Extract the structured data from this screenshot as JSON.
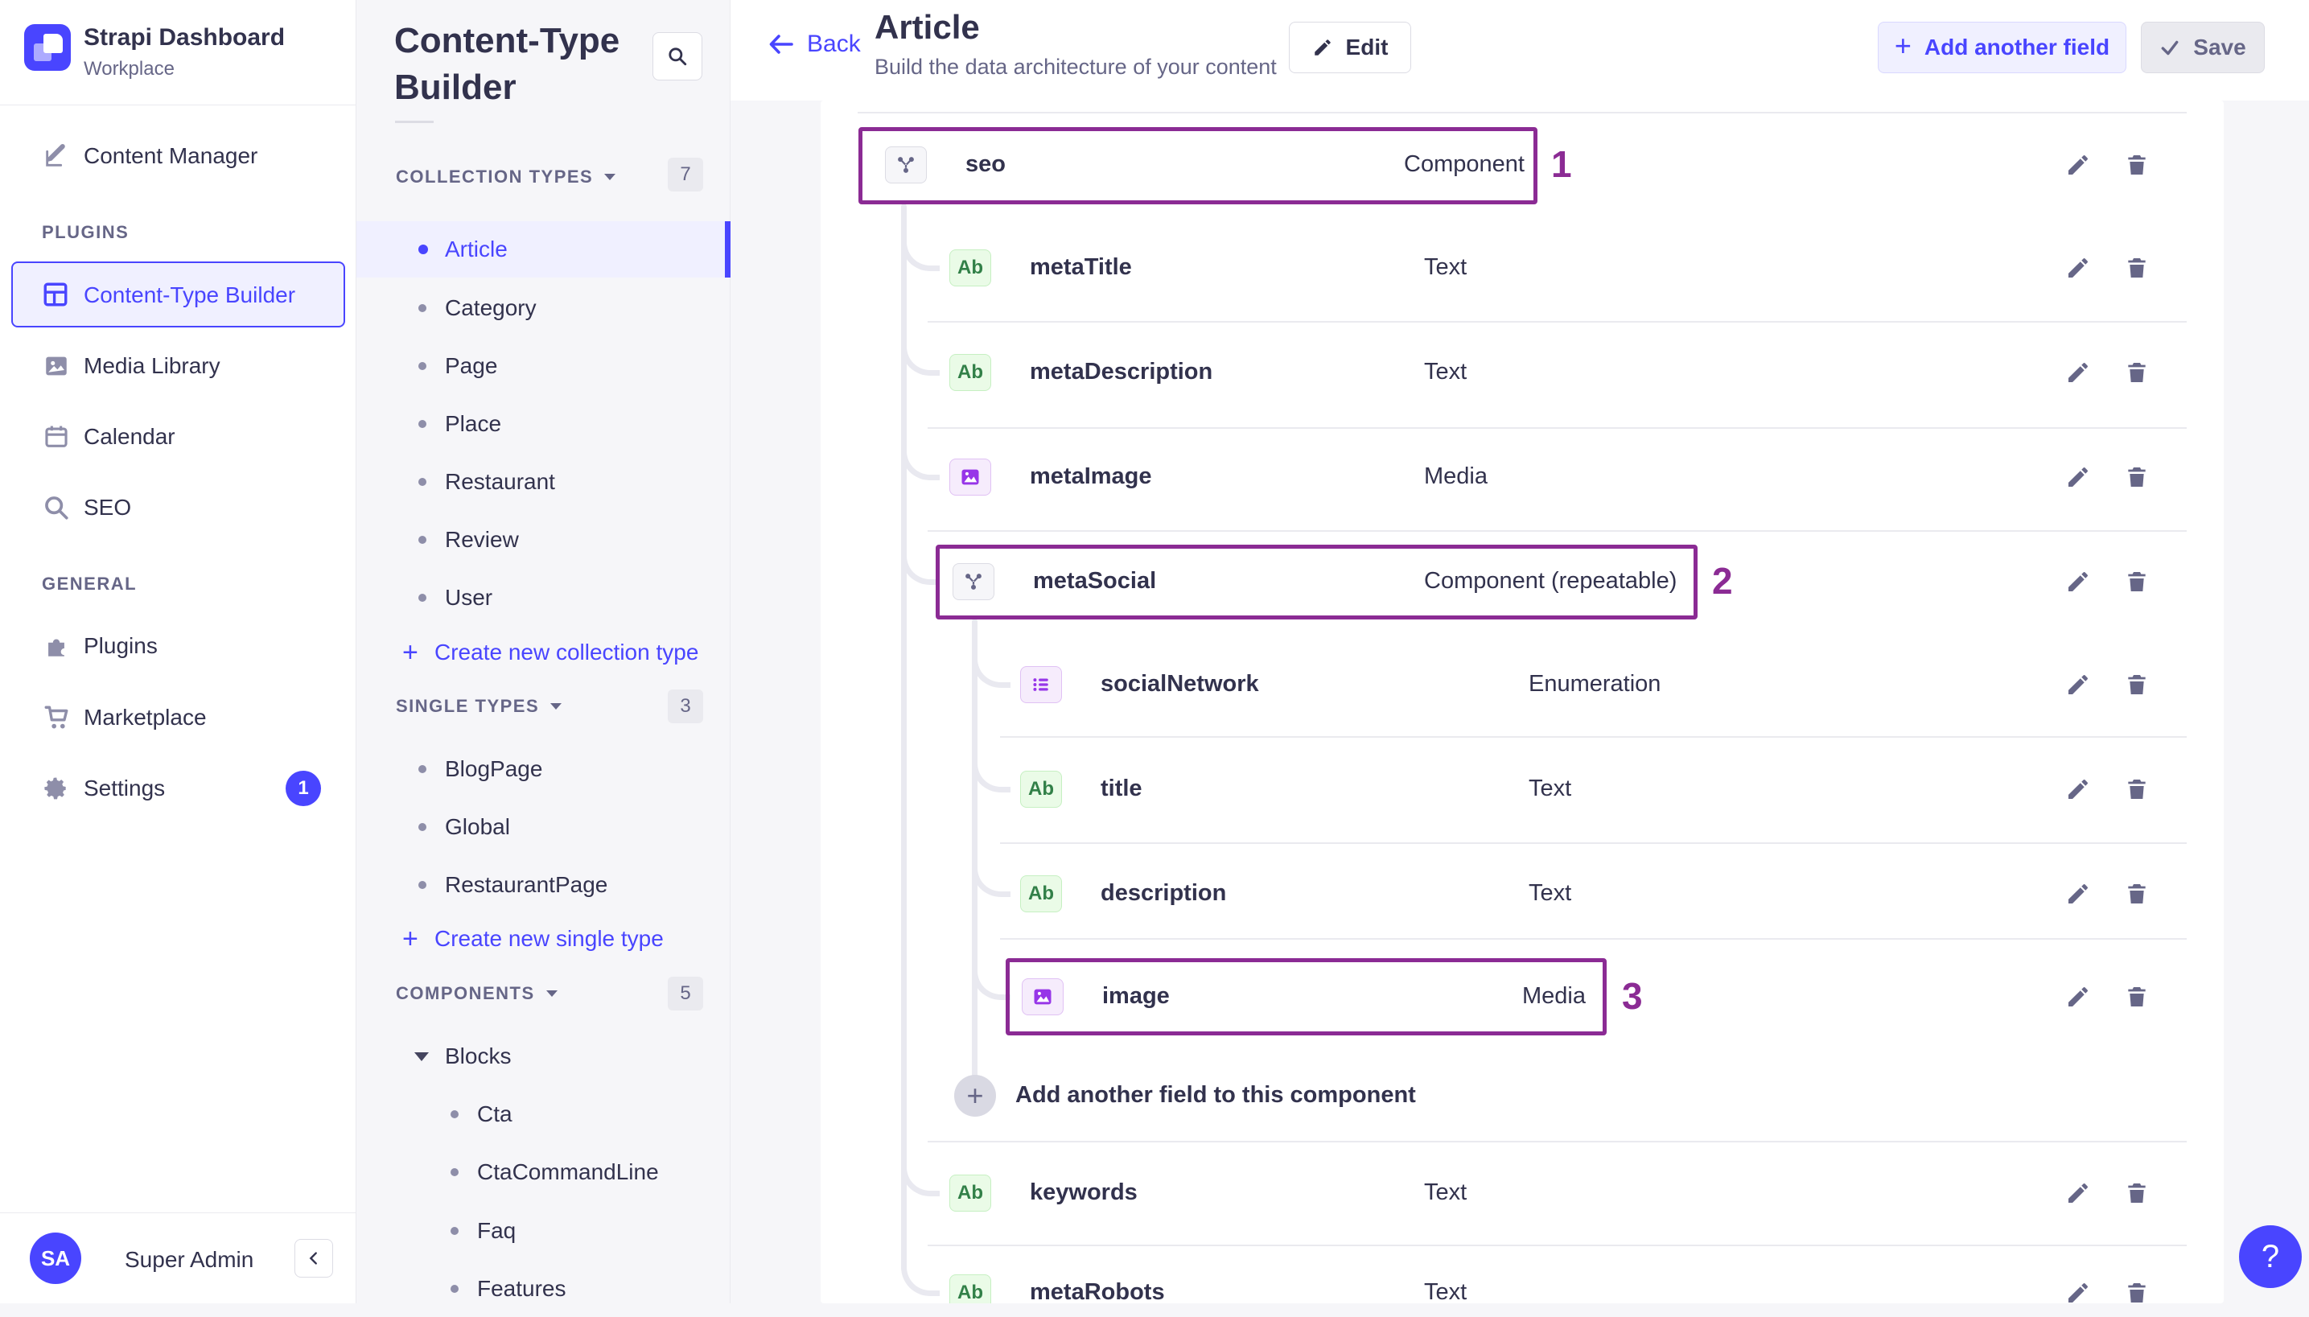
{
  "brand": {
    "title": "Strapi Dashboard",
    "subtitle": "Workplace"
  },
  "nav": {
    "content_manager": "Content Manager",
    "plugins_header": "PLUGINS",
    "content_type_builder": "Content-Type Builder",
    "media_library": "Media Library",
    "calendar": "Calendar",
    "seo": "SEO",
    "general_header": "GENERAL",
    "plugins": "Plugins",
    "marketplace": "Marketplace",
    "settings": "Settings",
    "settings_badge": "1",
    "user_initials": "SA",
    "user_name": "Super Admin"
  },
  "ctb_sidebar": {
    "title": "Content-Type Builder",
    "collection_types": {
      "label": "COLLECTION TYPES",
      "count": "7",
      "items": [
        "Article",
        "Category",
        "Page",
        "Place",
        "Restaurant",
        "Review",
        "User"
      ],
      "active_item": "Article",
      "action": "Create new collection type"
    },
    "single_types": {
      "label": "SINGLE TYPES",
      "count": "3",
      "items": [
        "BlogPage",
        "Global",
        "RestaurantPage"
      ],
      "action": "Create new single type"
    },
    "components": {
      "label": "COMPONENTS",
      "count": "5",
      "group": "Blocks",
      "items": [
        "Cta",
        "CtaCommandLine",
        "Faq",
        "Features"
      ]
    }
  },
  "header": {
    "back": "Back",
    "title": "Article",
    "subtitle": "Build the data architecture of your content",
    "edit": "Edit",
    "add_field": "Add another field",
    "save": "Save"
  },
  "table": {
    "rows": [
      {
        "name": "seo",
        "type": "Component"
      },
      {
        "name": "metaTitle",
        "type": "Text"
      },
      {
        "name": "metaDescription",
        "type": "Text"
      },
      {
        "name": "metaImage",
        "type": "Media"
      },
      {
        "name": "metaSocial",
        "type": "Component (repeatable)"
      },
      {
        "name": "socialNetwork",
        "type": "Enumeration"
      },
      {
        "name": "title",
        "type": "Text"
      },
      {
        "name": "description",
        "type": "Text"
      },
      {
        "name": "image",
        "type": "Media"
      },
      {
        "name": "keywords",
        "type": "Text"
      },
      {
        "name": "metaRobots",
        "type": "Text"
      }
    ],
    "add_row_label": "Add another field to this component",
    "annotations": [
      "1",
      "2",
      "3"
    ]
  },
  "help_label": "?",
  "colors": {
    "accent": "#4945FF",
    "annotation": "#8B2B94"
  }
}
